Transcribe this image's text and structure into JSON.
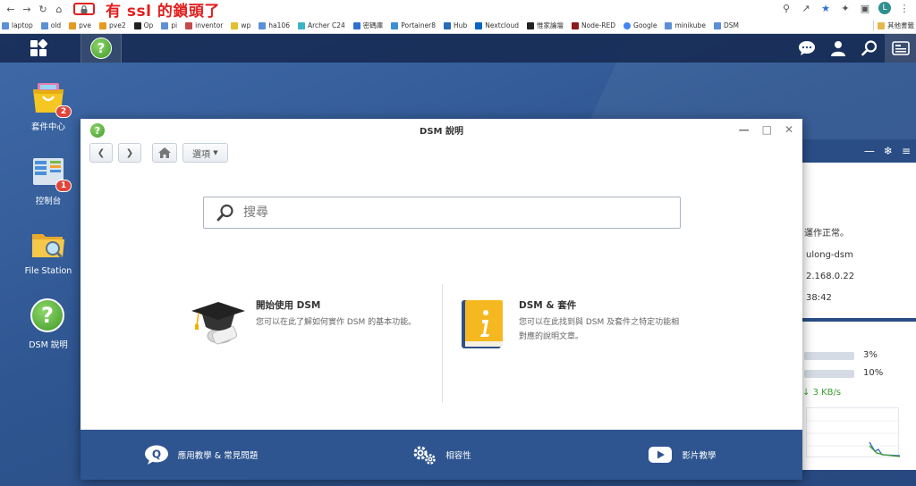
{
  "browser": {
    "annotation": "有 ssl 的鎖頭了",
    "bookmarks": [
      {
        "label": "laptop",
        "color": "#5b8fd6"
      },
      {
        "label": "old",
        "color": "#5b8fd6"
      },
      {
        "label": "pve",
        "color": "#e69a1f"
      },
      {
        "label": "pve2",
        "color": "#e69a1f"
      },
      {
        "label": "Op",
        "color": "#222222"
      },
      {
        "label": "pi",
        "color": "#5b8fd6"
      },
      {
        "label": "inventor",
        "color": "#c44b4b"
      },
      {
        "label": "wp",
        "color": "#e0c030"
      },
      {
        "label": "ha106",
        "color": "#5b8fd6"
      },
      {
        "label": "Archer C24",
        "color": "#3bb3c9"
      },
      {
        "label": "密碼庫",
        "color": "#2f6fd1"
      },
      {
        "label": "Portainer8",
        "color": "#3a8fd6"
      },
      {
        "label": "Hub",
        "color": "#2b6bb8"
      },
      {
        "label": "Nextcloud",
        "color": "#0a66c2"
      },
      {
        "label": "惟家論壇",
        "color": "#222222"
      },
      {
        "label": "Node-RED",
        "color": "#8b1a1a"
      },
      {
        "label": "Google",
        "color": "#4285f4"
      },
      {
        "label": "minikube",
        "color": "#5b8fd6"
      },
      {
        "label": "DSM",
        "color": "#5b8fd6"
      }
    ],
    "other_bookmarks": "其他書籤",
    "avatar_letter": "L"
  },
  "desktop": {
    "icons": [
      {
        "label": "套件中心",
        "badge": "2"
      },
      {
        "label": "控制台",
        "badge": "1"
      },
      {
        "label": "File Station",
        "badge": null
      },
      {
        "label": "DSM 說明",
        "badge": null
      }
    ]
  },
  "widget": {
    "status": "運作正常。",
    "hostname": "ulong-dsm",
    "ip": "2.168.0.22",
    "time": "38:42",
    "cpu": "3%",
    "ram": "10%",
    "net": "3 KB/s"
  },
  "help_window": {
    "title": "DSM 說明",
    "options_label": "選項",
    "search_placeholder": "搜尋",
    "card_left": {
      "title": "開始使用 DSM",
      "desc": "您可以在此了解如何實作 DSM 的基本功能。"
    },
    "card_right": {
      "title": "DSM & 套件",
      "desc_line1": "您可以在此找到與 DSM 及套件之特定功能相",
      "desc_line2": "對應的說明文章。"
    },
    "footer": {
      "faq": "應用教學 & 常見問題",
      "compat": "相容性",
      "video": "影片教學"
    }
  },
  "colors": {
    "desktop_bg": "#2f5691",
    "footer_bg": "#2e5590",
    "annotation_red": "#e02020",
    "help_green": "#3f9a28"
  }
}
